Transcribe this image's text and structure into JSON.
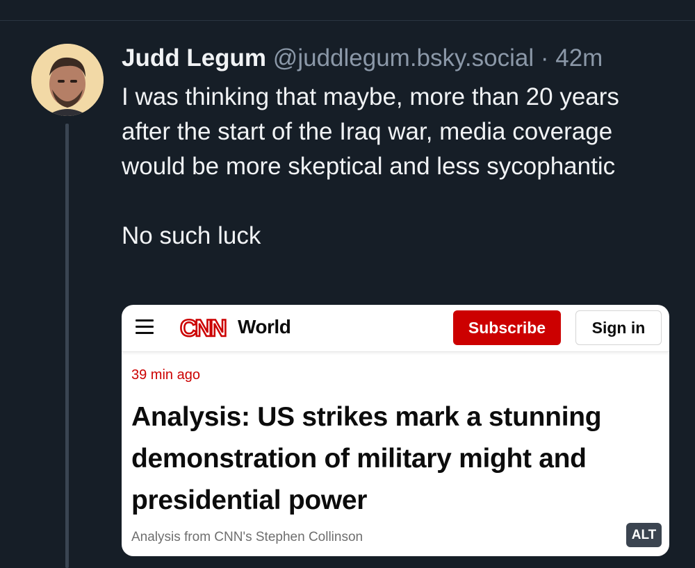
{
  "post": {
    "author_name": "Judd Legum",
    "author_handle": "@juddlegum.bsky.social",
    "separator": "·",
    "timestamp": "42m",
    "text": "I was thinking that maybe, more than 20 years after the start of the Iraq war, media coverage would be more skeptical and less sycophantic\n\nNo such luck"
  },
  "embed": {
    "logo_text": "CNN",
    "section": "World",
    "subscribe_label": "Subscribe",
    "signin_label": "Sign in",
    "article_time": "39 min ago",
    "headline": "Analysis: US strikes mark a stunning demonstration of military might and presidential power",
    "byline": "Analysis from CNN's Stephen Collinson",
    "alt_label": "ALT"
  },
  "colors": {
    "background": "#161e27",
    "cnn_red": "#cc0000",
    "muted_text": "#8b98a8"
  },
  "icons": {
    "menu": "hamburger-menu-icon",
    "logo": "cnn-logo"
  }
}
